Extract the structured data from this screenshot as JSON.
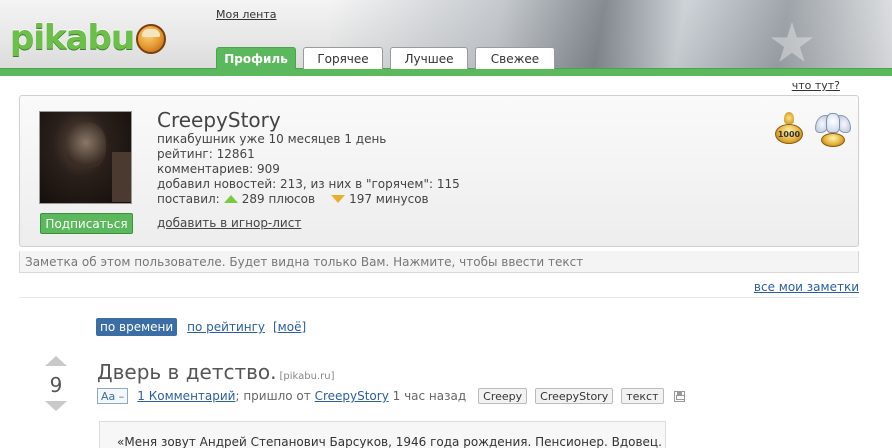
{
  "header": {
    "logo_text": "pikabu",
    "my_feed": "Моя лента",
    "tabs": [
      {
        "label": "Профиль",
        "active": true
      },
      {
        "label": "Горячее",
        "active": false
      },
      {
        "label": "Лучшее",
        "active": false
      },
      {
        "label": "Свежее",
        "active": false
      }
    ],
    "brand_color": "#5cb85c"
  },
  "what_here": "что тут?",
  "profile": {
    "username": "CreepyStory",
    "member_since": "пикабушник уже 10 месяцев 1 день",
    "rating": "рейтинг: 12861",
    "comments": "комментариев: 909",
    "news": "добавил новостей: 213, из них в \"горячем\": 115",
    "votes_label": "поставил:",
    "pluses": "289 плюсов",
    "minuses": "197 минусов",
    "subscribe_label": "Подписаться",
    "ignore_label": "добавить в игнор-лист",
    "badges": [
      {
        "icon": "1000-trophy-icon",
        "text": "1000"
      },
      {
        "icon": "angel-trophy-icon"
      }
    ]
  },
  "note": {
    "placeholder": "Заметка об этом пользователе. Будет видна только Вам. Нажмите, чтобы ввести текст",
    "all_notes": "все мои заметки"
  },
  "sort": {
    "by_time": "по времени",
    "by_rating": "по рейтингу",
    "mine": "[моё]"
  },
  "post": {
    "score": "9",
    "title": "Дверь в детство.",
    "source": "[pikabu.ru]",
    "font_button": "Аа –",
    "comments_link": "1 Комментарий",
    "came_from": "; пришло от",
    "author": "CreepyStory",
    "time": "1 час назад",
    "tags": [
      "Creepy",
      "CreepyStory",
      "текст"
    ],
    "body_preview": "«Меня зовут Андрей Степанович Барсуков, 1946 года рождения. Пенсионер. Вдовец."
  }
}
